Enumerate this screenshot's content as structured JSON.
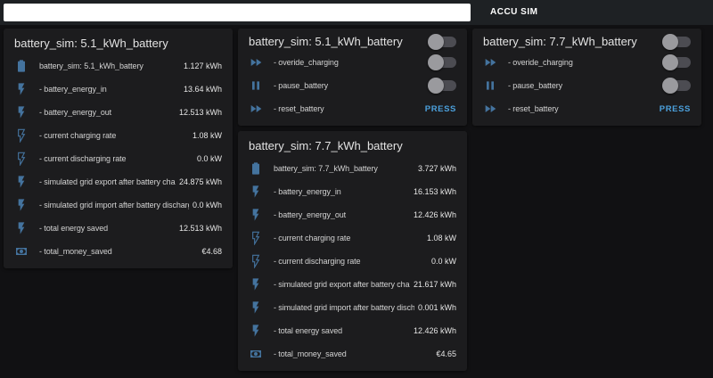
{
  "theme": {
    "bg": "#111113",
    "card-bg": "#1c1c1e",
    "icon-color": "#44739e",
    "press-color": "#4ba0dc",
    "topbar-bg": "#1e2124"
  },
  "topbar": {
    "search_value": "",
    "search_placeholder": "",
    "tab": "ACCU SIM"
  },
  "cards": {
    "sensor51": {
      "title": "battery_sim: 5.1_kWh_battery",
      "rows": [
        {
          "icon": "battery-icon",
          "label": "battery_sim: 5.1_kWh_battery",
          "value": "1.127 kWh"
        },
        {
          "icon": "flash-icon",
          "label": "- battery_energy_in",
          "value": "13.64 kWh"
        },
        {
          "icon": "flash-icon",
          "label": "- battery_energy_out",
          "value": "12.513 kWh"
        },
        {
          "icon": "flash-outline-icon",
          "label": "- current charging rate",
          "value": "1.08 kW"
        },
        {
          "icon": "flash-outline-icon",
          "label": "- current discharging rate",
          "value": "0.0 kW"
        },
        {
          "icon": "flash-icon",
          "label": "- simulated grid export after battery charging",
          "value": "24.875 kWh"
        },
        {
          "icon": "flash-icon",
          "label": "- simulated grid import after battery discharging",
          "value": "0.0 kWh"
        },
        {
          "icon": "flash-icon",
          "label": "- total energy saved",
          "value": "12.513 kWh"
        },
        {
          "icon": "cash-icon",
          "label": "- total_money_saved",
          "value": "€4.68"
        }
      ]
    },
    "controls51": {
      "title": "battery_sim: 5.1_kWh_battery",
      "rows": [
        {
          "icon": "fast-forward-icon",
          "label": "- overide_charging",
          "control": "toggle"
        },
        {
          "icon": "pause-icon",
          "label": "- pause_battery",
          "control": "toggle"
        },
        {
          "icon": "fast-forward-icon",
          "label": "- reset_battery",
          "control": "button",
          "button_label": "PRESS"
        }
      ]
    },
    "controls77": {
      "title": "battery_sim: 7.7_kWh_battery",
      "rows": [
        {
          "icon": "fast-forward-icon",
          "label": "- overide_charging",
          "control": "toggle"
        },
        {
          "icon": "pause-icon",
          "label": "- pause_battery",
          "control": "toggle"
        },
        {
          "icon": "fast-forward-icon",
          "label": "- reset_battery",
          "control": "button",
          "button_label": "PRESS"
        }
      ]
    },
    "sensor77": {
      "title": "battery_sim: 7.7_kWh_battery",
      "rows": [
        {
          "icon": "battery-icon",
          "label": "battery_sim: 7.7_kWh_battery",
          "value": "3.727 kWh"
        },
        {
          "icon": "flash-icon",
          "label": "- battery_energy_in",
          "value": "16.153 kWh"
        },
        {
          "icon": "flash-icon",
          "label": "- battery_energy_out",
          "value": "12.426 kWh"
        },
        {
          "icon": "flash-outline-icon",
          "label": "- current charging rate",
          "value": "1.08 kW"
        },
        {
          "icon": "flash-outline-icon",
          "label": "- current discharging rate",
          "value": "0.0 kW"
        },
        {
          "icon": "flash-icon",
          "label": "- simulated grid export after battery charging",
          "value": "21.617 kWh"
        },
        {
          "icon": "flash-icon",
          "label": "- simulated grid import after battery discharging",
          "value": "0.001 kWh"
        },
        {
          "icon": "flash-icon",
          "label": "- total energy saved",
          "value": "12.426 kWh"
        },
        {
          "icon": "cash-icon",
          "label": "- total_money_saved",
          "value": "€4.65"
        }
      ]
    }
  }
}
